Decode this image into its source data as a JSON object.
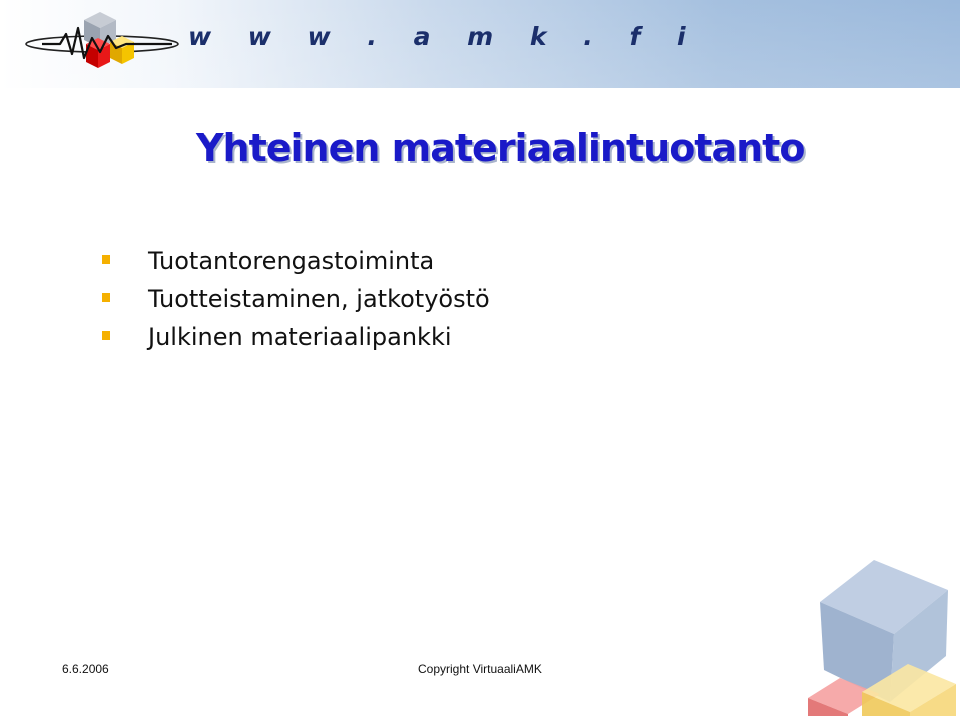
{
  "header": {
    "url": "w w w . a m k . f i",
    "accent": "#1b2f6b"
  },
  "slide": {
    "title": "Yhteinen materiaalintuotanto",
    "title_color": "#1a1ac8",
    "bullet_color": "#f5b000",
    "bullets": [
      "Tuotantorengastoiminta",
      "Tuotteistaminen, jatkotyöstö",
      "Julkinen materiaalipankki"
    ]
  },
  "footer": {
    "date": "6.6.2006",
    "copyright": "Copyright VirtuaaliAMK"
  }
}
